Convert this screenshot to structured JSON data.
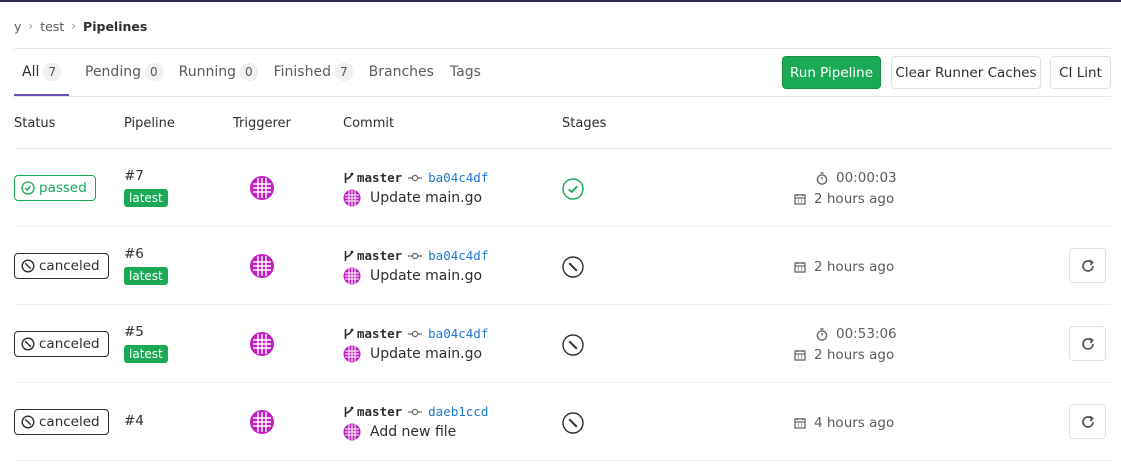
{
  "breadcrumb": {
    "items": [
      "y",
      "test"
    ],
    "current": "Pipelines"
  },
  "tabs": [
    {
      "label": "All",
      "count": "7",
      "active": true
    },
    {
      "label": "Pending",
      "count": "0"
    },
    {
      "label": "Running",
      "count": "0"
    },
    {
      "label": "Finished",
      "count": "7"
    },
    {
      "label": "Branches"
    },
    {
      "label": "Tags"
    }
  ],
  "actions": {
    "run": "Run Pipeline",
    "clear": "Clear Runner Caches",
    "lint": "CI Lint"
  },
  "columns": {
    "status": "Status",
    "pipeline": "Pipeline",
    "triggerer": "Triggerer",
    "commit": "Commit",
    "stages": "Stages"
  },
  "colors": {
    "success": "#1aaa55",
    "link": "#1f78d1",
    "accent": "#6b4fbb",
    "avatar": "#c020c0"
  },
  "rows": [
    {
      "status": "passed",
      "id": "#7",
      "latest": "latest",
      "branch": "master",
      "sha": "ba04c4df",
      "title": "Update main.go",
      "stage": "success",
      "duration": "00:00:03",
      "finished": "2 hours ago",
      "retry": false
    },
    {
      "status": "canceled",
      "id": "#6",
      "latest": "latest",
      "branch": "master",
      "sha": "ba04c4df",
      "title": "Update main.go",
      "stage": "canceled",
      "finished": "2 hours ago",
      "retry": true
    },
    {
      "status": "canceled",
      "id": "#5",
      "latest": "latest",
      "branch": "master",
      "sha": "ba04c4df",
      "title": "Update main.go",
      "stage": "canceled",
      "duration": "00:53:06",
      "finished": "2 hours ago",
      "retry": true
    },
    {
      "status": "canceled",
      "id": "#4",
      "branch": "master",
      "sha": "daeb1ccd",
      "title": "Add new file",
      "stage": "canceled",
      "finished": "4 hours ago",
      "retry": true
    }
  ]
}
